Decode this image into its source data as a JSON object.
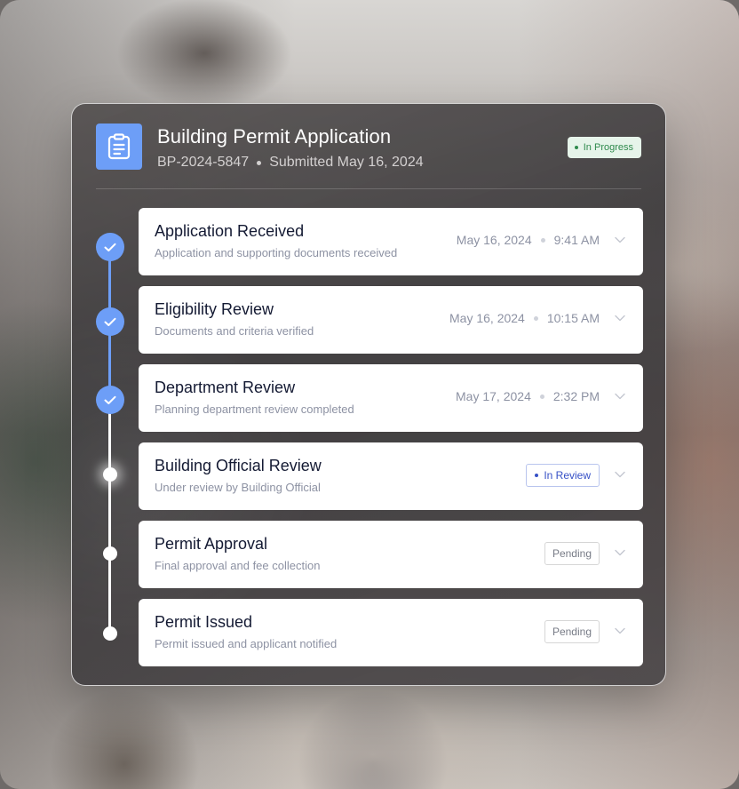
{
  "header": {
    "title": "Building Permit Application",
    "permit_id": "BP-2024-5847",
    "submitted": "Submitted May 16, 2024",
    "status_badge": "In Progress",
    "icon": "clipboard-icon"
  },
  "steps": [
    {
      "title": "Application Received",
      "description": "Application and supporting documents received",
      "date": "May 16, 2024",
      "time": "9:41 AM",
      "state": "completed"
    },
    {
      "title": "Eligibility Review",
      "description": "Documents and criteria verified",
      "date": "May 16, 2024",
      "time": "10:15 AM",
      "state": "completed"
    },
    {
      "title": "Department Review",
      "description": "Planning department review completed",
      "date": "May 17, 2024",
      "time": "2:32 PM",
      "state": "completed"
    },
    {
      "title": "Building Official Review",
      "description": "Under review by Building Official",
      "status": "In Review",
      "state": "current"
    },
    {
      "title": "Permit Approval",
      "description": "Final approval and fee collection",
      "status": "Pending",
      "state": "pending"
    },
    {
      "title": "Permit Issued",
      "description": "Permit issued and applicant notified",
      "status": "Pending",
      "state": "pending"
    }
  ],
  "colors": {
    "accent": "#6d9ef7",
    "in_progress": "#2f8a4d",
    "in_review": "#3650c6"
  }
}
